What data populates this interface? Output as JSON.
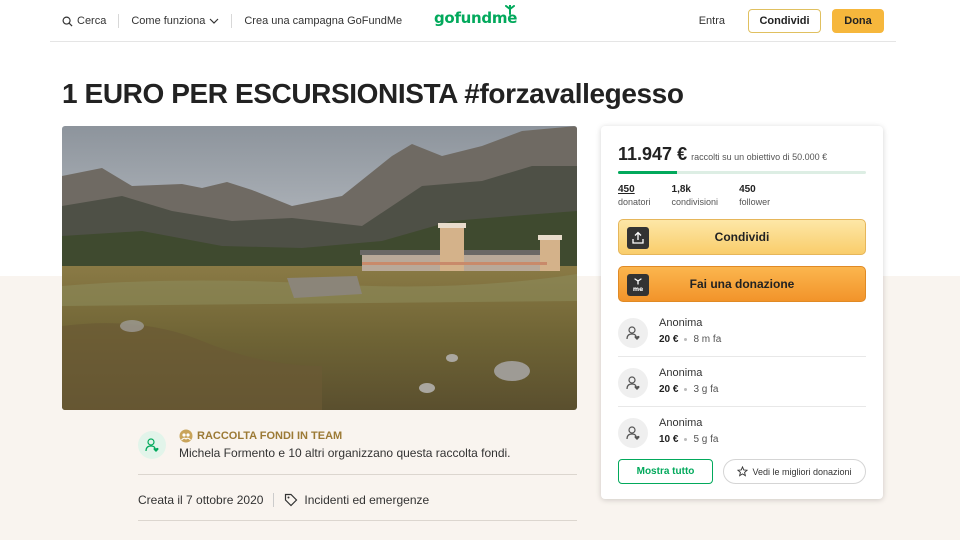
{
  "header": {
    "search_label": "Cerca",
    "how_label": "Come funziona",
    "create_label": "Crea una campagna GoFundMe",
    "logo_text": "gofundme",
    "login_label": "Entra",
    "share_label": "Condividi",
    "donate_label": "Dona",
    "icons": [
      "search-icon",
      "chevron-down-icon",
      "sprout-icon"
    ]
  },
  "campaign": {
    "title": "1 EURO PER ESCURSIONISTA #forzavallegesso"
  },
  "organizer": {
    "team_label": "RACCOLTA FONDI IN TEAM",
    "text": "Michela Formento e 10 altri organizzano questa raccolta fondi.",
    "created": "Creata il 7 ottobre 2020",
    "category": "Incidenti ed emergenze"
  },
  "card": {
    "raised": "11.947 €",
    "goal_text": "raccolti su un obiettivo di 50.000 €",
    "progress_fraction": 0.239,
    "stats": [
      {
        "value": "450",
        "label": "donatori"
      },
      {
        "value": "1,8k",
        "label": "condivisioni"
      },
      {
        "value": "450",
        "label": "follower"
      }
    ],
    "share_label": "Condividi",
    "donate_label": "Fai una donazione",
    "donations": [
      {
        "name": "Anonima",
        "amount": "20 €",
        "time": "8 m fa"
      },
      {
        "name": "Anonima",
        "amount": "20 €",
        "time": "3 g fa"
      },
      {
        "name": "Anonima",
        "amount": "10 €",
        "time": "5 g fa"
      }
    ],
    "show_all_label": "Mostra tutto",
    "best_label": "Vedi le migliori donazioni"
  },
  "colors": {
    "brand_green": "#02a95c",
    "donate_orange": "#f2942a",
    "share_yellow": "#f9cd6b",
    "team_gold": "#9c7a35"
  }
}
